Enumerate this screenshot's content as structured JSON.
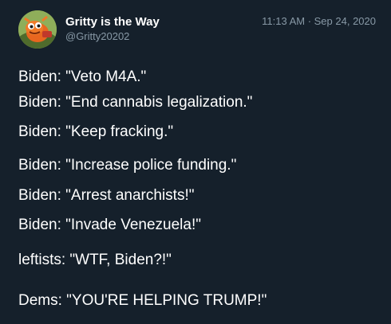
{
  "tweet": {
    "author": {
      "display_name": "Gritty is the Way",
      "handle": "@Gritty20202",
      "avatar_icon": "gritty-mascot-avatar"
    },
    "timestamp": "11:13 AM · Sep 24, 2020",
    "lines": [
      "Biden: \"Veto M4A.\"",
      "Biden: \"End cannabis legalization.\"",
      "Biden: \"Keep fracking.\"",
      "Biden: \"Increase police funding.\"",
      "Biden: \"Arrest anarchists!\"",
      "Biden: \"Invade Venezuela!\"",
      "leftists: \"WTF, Biden?!\"",
      "Dems: \"YOU'RE HELPING TRUMP!\""
    ]
  },
  "colors": {
    "background": "#15202b",
    "text_primary": "#ffffff",
    "text_secondary": "#8899a6"
  }
}
